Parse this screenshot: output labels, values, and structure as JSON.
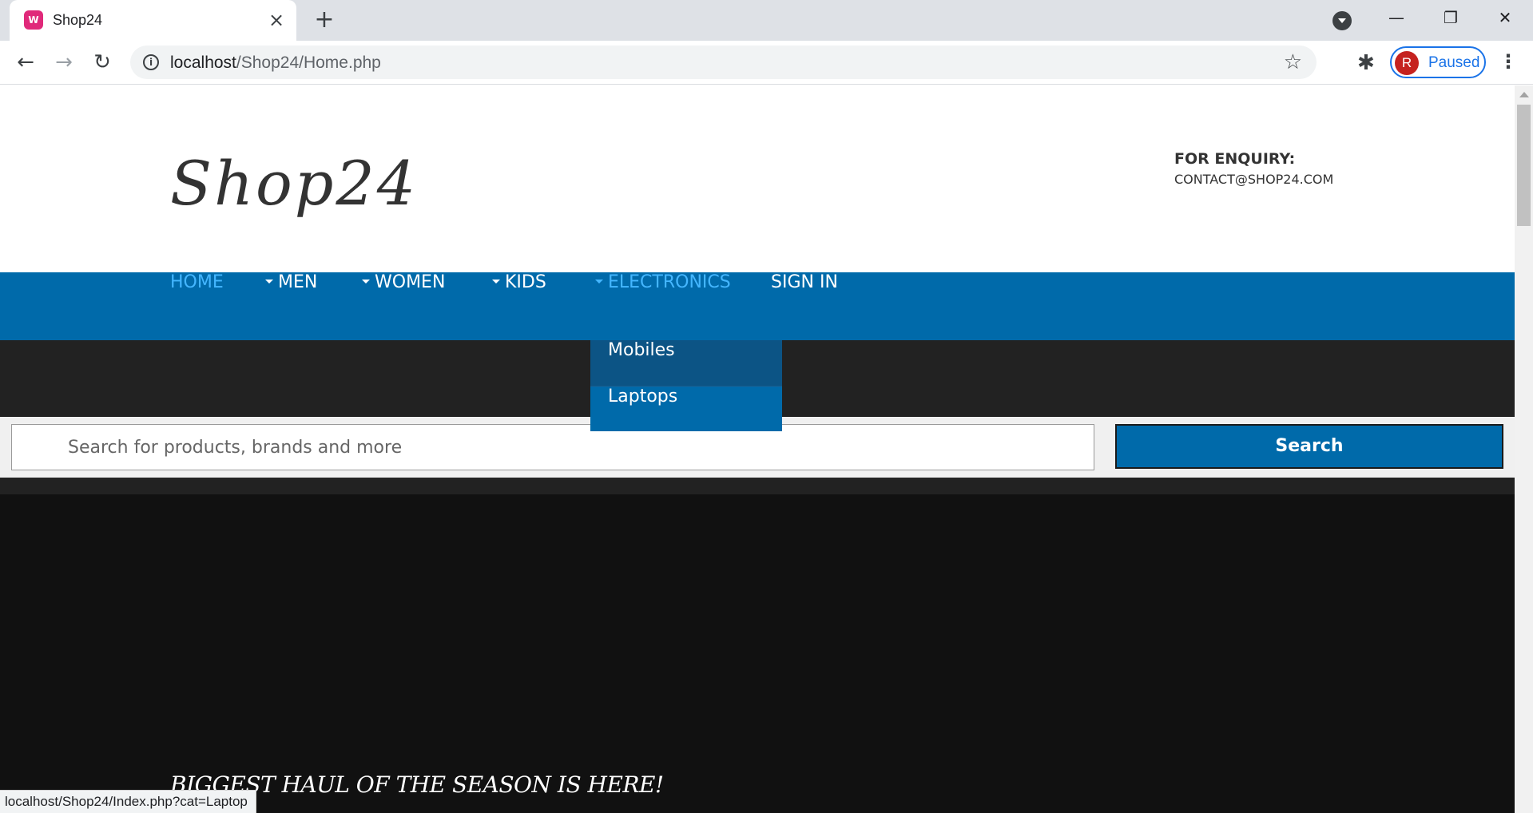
{
  "browser": {
    "tab": {
      "title": "Shop24",
      "favicon_icon": "wamp-icon",
      "close_icon": "×"
    },
    "new_tab_icon": "+",
    "window_controls": {
      "minimize": "—",
      "maximize": "❐",
      "close": "✕"
    },
    "nav": {
      "back": "←",
      "forward": "→",
      "reload": "↻"
    },
    "url": {
      "host": "localhost",
      "path": "/Shop24/Home.php"
    },
    "profile": {
      "initial": "R",
      "label": "Paused"
    },
    "status_url": "localhost/Shop24/Index.php?cat=Laptop",
    "colors": {
      "accent": "#1a73e8",
      "avatar": "#c5221f"
    }
  },
  "site": {
    "logo": "Shop24",
    "enquiry": {
      "title": "FOR ENQUIRY:",
      "email": "CONTACT@SHOP24.COM"
    },
    "nav": {
      "home": "HOME",
      "men": "MEN",
      "women": "WOMEN",
      "kids": "KIDS",
      "electronics": "ELECTRONICS",
      "signin": "SIGN IN"
    },
    "dropdown": {
      "mobiles": "Mobiles",
      "laptops": "Laptops"
    },
    "search": {
      "placeholder": "Search for products, brands and more",
      "value": "",
      "button": "Search"
    },
    "hero": {
      "text": "BIGGEST HAUL OF THE SEASON IS HERE!"
    },
    "colors": {
      "nav_bg": "#006aaa",
      "nav_active": "#44b6ff",
      "dark_band": "#222222",
      "hero_bg": "#111111"
    }
  }
}
